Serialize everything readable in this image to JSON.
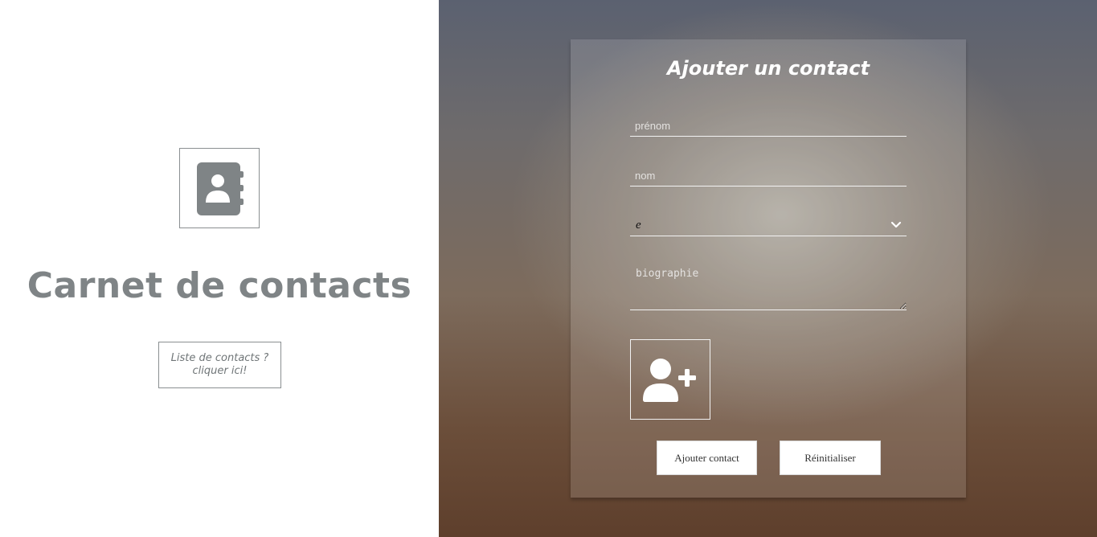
{
  "left_panel": {
    "logo_icon": "address-book-icon",
    "title": "Carnet de contacts",
    "list_link_line1": "Liste de contacts ?",
    "list_link_line2": "cliquer ici!"
  },
  "form": {
    "title": "Ajouter un contact",
    "prenom_placeholder": "prénom",
    "nom_placeholder": "nom",
    "select_value": "e",
    "biographie_placeholder": "biographie",
    "photo_icon": "user-plus-icon",
    "add_button": "Ajouter contact",
    "reset_button": "Réinitialiser"
  },
  "colors": {
    "title_gray": "#7f8486",
    "border_gray": "#8a8f91"
  }
}
